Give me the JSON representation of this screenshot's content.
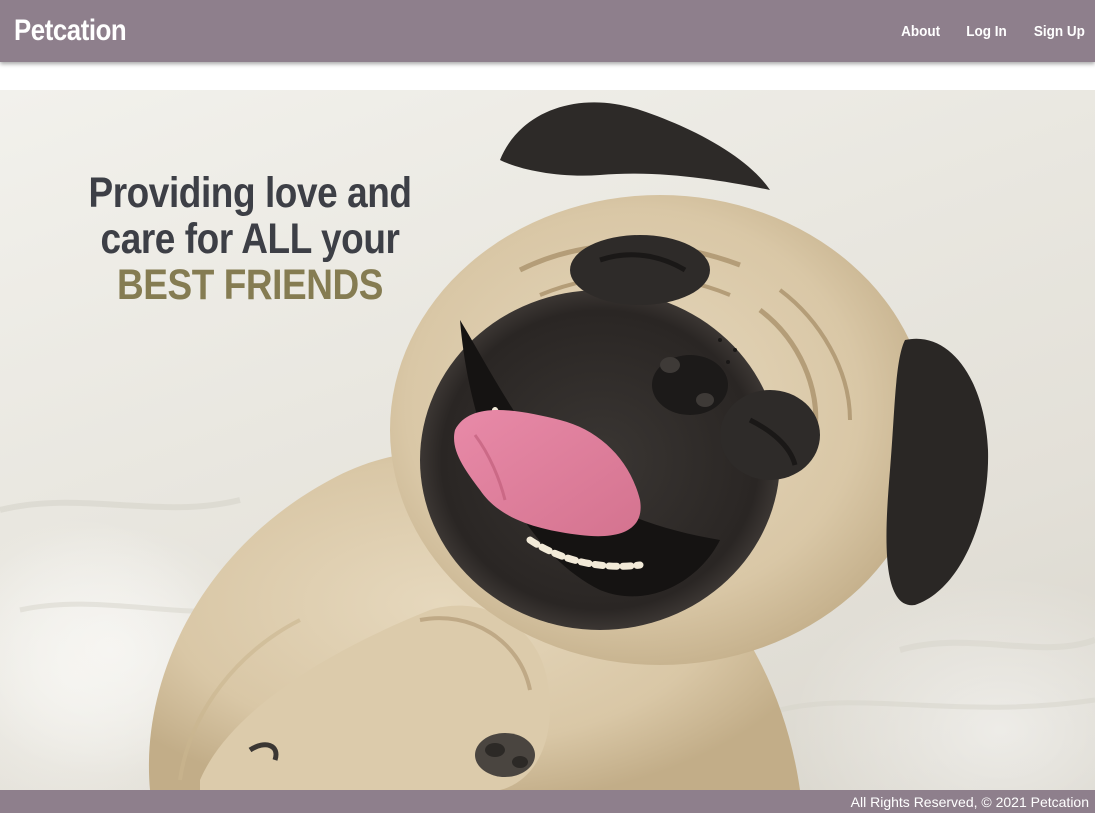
{
  "navbar": {
    "brand": "Petcation",
    "links": [
      {
        "label": "About"
      },
      {
        "label": "Log In"
      },
      {
        "label": "Sign Up"
      }
    ]
  },
  "hero": {
    "headline_line1": "Providing love and",
    "headline_line2": "care for ALL your",
    "headline_accent": "BEST FRIENDS",
    "image": "pug-dog-photo"
  },
  "footer": {
    "text": "All Rights Reserved, © 2021 Petcation"
  },
  "colors": {
    "navbar": "#8e7f8c",
    "headline": "#3d3f46",
    "accent": "#857c52",
    "footer": "#8e7f8c"
  }
}
